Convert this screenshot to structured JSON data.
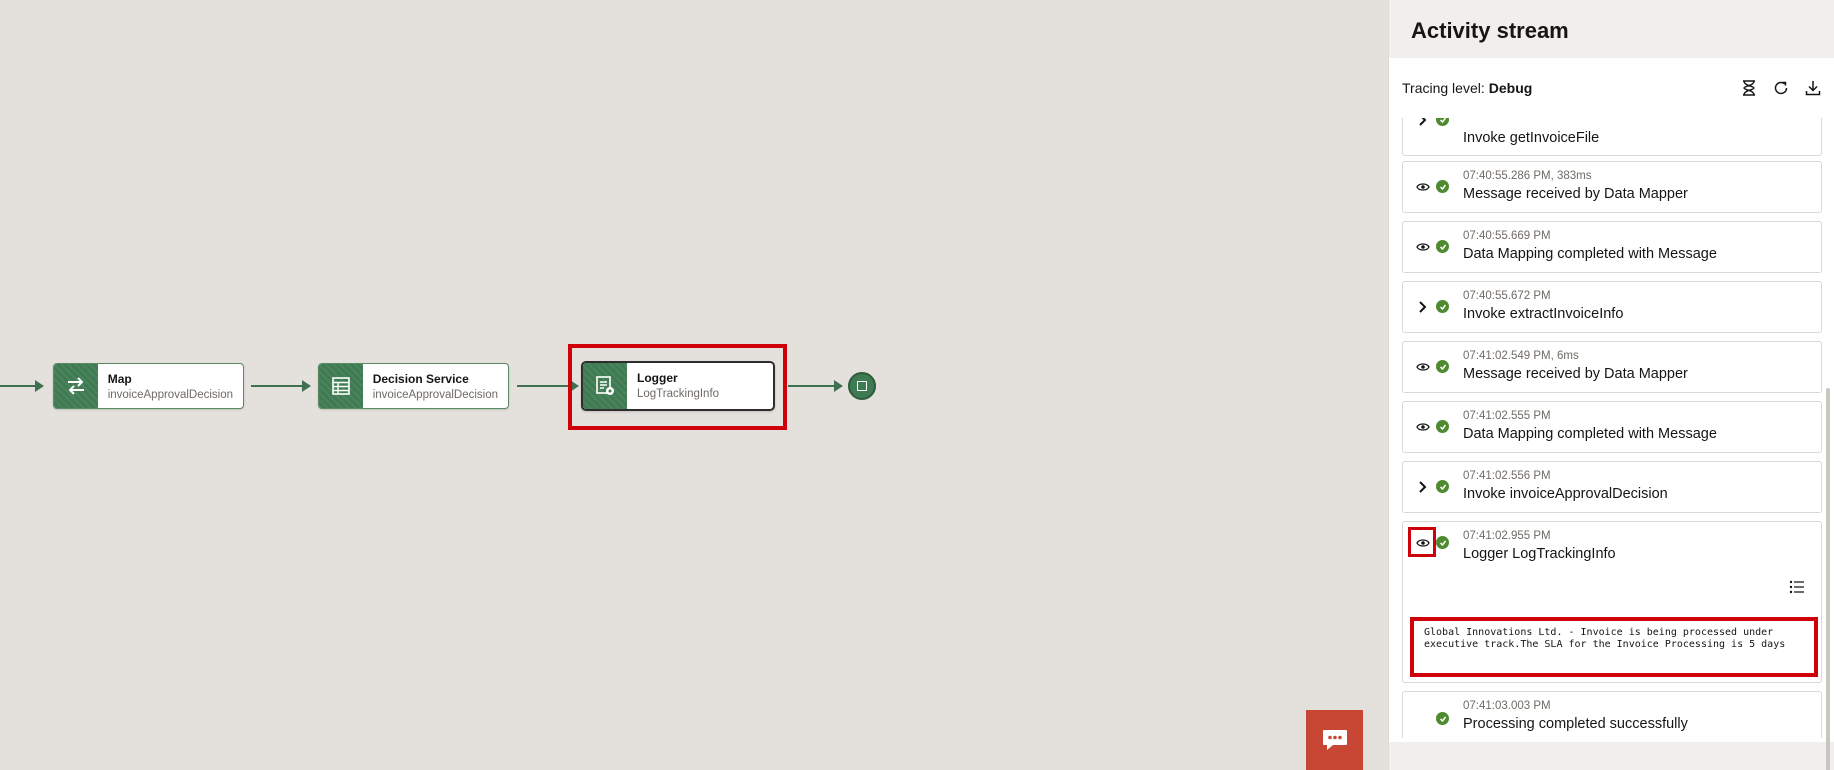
{
  "flow": {
    "nodes": [
      {
        "title": "Map",
        "subtitle": "invoiceApprovalDecision",
        "icon": "swap-arrows-icon"
      },
      {
        "title": "Decision Service",
        "subtitle": "invoiceApprovalDecision",
        "icon": "table-icon"
      },
      {
        "title": "Logger",
        "subtitle": "LogTrackingInfo",
        "icon": "logger-icon",
        "selected": true
      }
    ],
    "end_icon": "stop-icon"
  },
  "chat_button": {
    "icon": "chat-bubble-icon"
  },
  "panel": {
    "title": "Activity stream",
    "tracing_label": "Tracing level:",
    "tracing_value": "Debug",
    "toolbar_icons": [
      "hourglass-icon",
      "refresh-icon",
      "download-icon"
    ],
    "items": [
      {
        "time": "",
        "label": "Invoke getInvoiceFile",
        "lead": "chevron"
      },
      {
        "time": "07:40:55.286 PM, 383ms",
        "label": "Message received by Data Mapper",
        "lead": "eye"
      },
      {
        "time": "07:40:55.669 PM",
        "label": "Data Mapping completed with Message",
        "lead": "eye"
      },
      {
        "time": "07:40:55.672 PM",
        "label": "Invoke extractInvoiceInfo",
        "lead": "chevron"
      },
      {
        "time": "07:41:02.549 PM, 6ms",
        "label": "Message received by Data Mapper",
        "lead": "eye"
      },
      {
        "time": "07:41:02.555 PM",
        "label": "Data Mapping completed with Message",
        "lead": "eye"
      },
      {
        "time": "07:41:02.556 PM",
        "label": "Invoke invoiceApprovalDecision",
        "lead": "chevron"
      },
      {
        "time": "07:41:02.955 PM",
        "label": "Logger LogTrackingInfo",
        "lead": "eye",
        "log_message": "Global Innovations Ltd. - Invoice is being processed under executive track.The SLA for the Invoice Processing is 5 days"
      },
      {
        "time": "07:41:03.003 PM",
        "label": "Processing completed successfully",
        "lead": "none"
      }
    ]
  },
  "colors": {
    "accent": "#3f7b52",
    "highlight": "#d0000a",
    "success": "#508a2f",
    "chat": "#c74634"
  }
}
